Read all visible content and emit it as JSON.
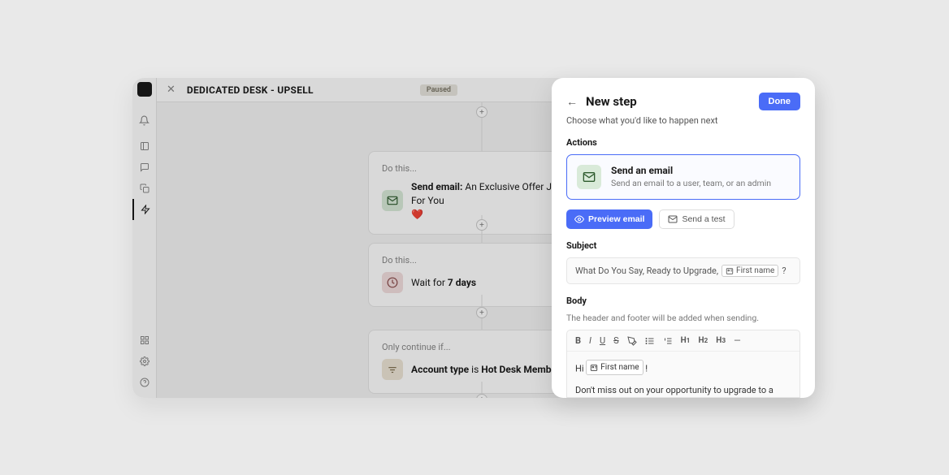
{
  "header": {
    "title": "DEDICATED DESK - UPSELL",
    "status": "Paused"
  },
  "nodes": {
    "n1": {
      "label": "Do this...",
      "action_prefix": "Send email:",
      "action_text": "An Exclusive Offer Just For You"
    },
    "n2": {
      "label": "Do this...",
      "action_prefix": "Wait for",
      "action_text": "7 days"
    },
    "n3": {
      "label": "Only continue if...",
      "field": "Account type",
      "verb": "is",
      "value": "Hot Desk Member"
    }
  },
  "panel": {
    "title": "New step",
    "subtitle": "Choose what you'd like to happen next",
    "done_label": "Done",
    "actions_label": "Actions",
    "action": {
      "title": "Send an email",
      "desc": "Send an email to a user, team, or an admin"
    },
    "preview_label": "Preview email",
    "test_label": "Send a test",
    "subject_label": "Subject",
    "subject_text_a": "What Do You Say, Ready to Upgrade,",
    "subject_token": "First name",
    "subject_text_b": "?",
    "body_label": "Body",
    "body_note": "The header and footer will be added when sending.",
    "body_greeting_prefix": "Hi",
    "body_greeting_token": "First name",
    "body_greeting_suffix": "!",
    "body_paragraph": "Don't miss out on your opportunity to upgrade to a Dedicated Desk Plan! Reach out to us today and we'll give you one month free."
  }
}
